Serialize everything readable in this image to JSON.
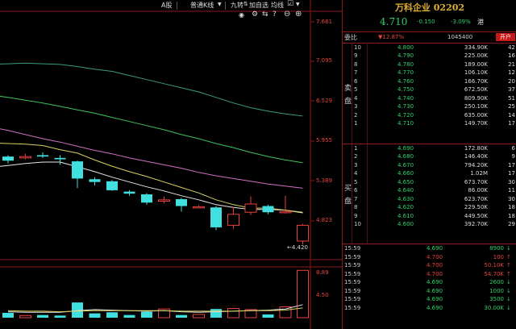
{
  "toolbar": {
    "market": "A股",
    "chart_type": "普通K线",
    "nine_turn": "九转",
    "add_watch": "加自选",
    "ma_toggle": "均线"
  },
  "price_axis": {
    "ticks": [
      "7.661",
      "7.095",
      "6.529",
      "5.955",
      "5.389",
      "4.823"
    ],
    "low_marker": "4.420"
  },
  "volume_axis": {
    "ticks": [
      "8.89",
      "4.50"
    ]
  },
  "colors": {
    "up": "#e84040",
    "down": "#40e0e0",
    "ma_white": "#e8e8e8",
    "ma_yellow": "#d8d060",
    "ma_pink": "#d070c0",
    "ma_green": "#40c060",
    "ma_teal": "#3a9a80"
  },
  "chart_data": {
    "type": "candlestick",
    "ylim": [
      4.2,
      7.661
    ],
    "candles": [
      {
        "o": 5.7,
        "c": 5.64,
        "h": 5.72,
        "l": 5.6
      },
      {
        "o": 5.68,
        "c": 5.7,
        "h": 5.74,
        "l": 5.66
      },
      {
        "o": 5.72,
        "c": 5.7,
        "h": 5.76,
        "l": 5.68
      },
      {
        "o": 5.68,
        "c": 5.66,
        "h": 5.72,
        "l": 5.58
      },
      {
        "o": 5.63,
        "c": 5.38,
        "h": 5.64,
        "l": 5.24
      },
      {
        "o": 5.37,
        "c": 5.33,
        "h": 5.4,
        "l": 5.28
      },
      {
        "o": 5.34,
        "c": 5.21,
        "h": 5.36,
        "l": 5.2
      },
      {
        "o": 5.19,
        "c": 5.16,
        "h": 5.21,
        "l": 5.13
      },
      {
        "o": 5.15,
        "c": 5.03,
        "h": 5.17,
        "l": 5.0
      },
      {
        "o": 5.05,
        "c": 5.07,
        "h": 5.12,
        "l": 5.02
      },
      {
        "o": 5.08,
        "c": 4.98,
        "h": 5.1,
        "l": 4.9
      },
      {
        "o": 4.96,
        "c": 4.97,
        "h": 4.99,
        "l": 4.95
      },
      {
        "o": 4.96,
        "c": 4.67,
        "h": 4.98,
        "l": 4.63
      },
      {
        "o": 4.7,
        "c": 4.86,
        "h": 4.97,
        "l": 4.65
      },
      {
        "o": 4.89,
        "c": 5.01,
        "h": 5.12,
        "l": 4.85
      },
      {
        "o": 4.98,
        "c": 4.89,
        "h": 5.0,
        "l": 4.86
      },
      {
        "o": 4.9,
        "c": 4.9,
        "h": 5.13,
        "l": 4.87
      },
      {
        "o": 4.47,
        "c": 4.7,
        "h": 4.72,
        "l": 4.42
      }
    ],
    "ma_lines": [
      {
        "name": "ma-white",
        "color": "#e8e8e8",
        "values": [
          5.57,
          5.6,
          5.62,
          5.62,
          5.55,
          5.48,
          5.4,
          5.33,
          5.26,
          5.2,
          5.13,
          5.07,
          5.0,
          4.96,
          4.93,
          4.93,
          4.92,
          4.88
        ]
      },
      {
        "name": "ma-yellow",
        "color": "#d8d060",
        "values": [
          5.89,
          5.88,
          5.86,
          5.8,
          5.75,
          5.65,
          5.56,
          5.48,
          5.41,
          5.33,
          5.25,
          5.17,
          5.07,
          5.0,
          4.95,
          4.95,
          4.92,
          4.89
        ]
      },
      {
        "name": "ma-pink",
        "color": "#d070c0",
        "values": [
          6.08,
          6.02,
          5.96,
          5.91,
          5.85,
          5.79,
          5.74,
          5.68,
          5.63,
          5.58,
          5.53,
          5.47,
          5.42,
          5.38,
          5.34,
          5.3,
          5.27,
          5.24
        ]
      },
      {
        "name": "ma-green",
        "color": "#40c060",
        "values": [
          6.56,
          6.52,
          6.48,
          6.43,
          6.38,
          6.33,
          6.27,
          6.21,
          6.15,
          6.09,
          6.02,
          5.96,
          5.89,
          5.83,
          5.76,
          5.7,
          5.65,
          5.61
        ]
      },
      {
        "name": "ma-teal",
        "color": "#3a9a80",
        "values": [
          7.05,
          7.06,
          7.05,
          7.04,
          7.01,
          6.97,
          6.94,
          6.88,
          6.82,
          6.76,
          6.7,
          6.64,
          6.56,
          6.48,
          6.41,
          6.36,
          6.32,
          6.29
        ]
      }
    ],
    "volume": {
      "ylim": [
        0,
        8.89
      ],
      "bars": [
        0.9,
        0.4,
        0.5,
        0.4,
        2.8,
        0.8,
        1.0,
        0.5,
        1.1,
        1.6,
        0.5,
        0.6,
        1.6,
        1.7,
        1.5,
        0.6,
        2.0,
        8.7
      ],
      "vol_ma_white": [
        1.1,
        1.0,
        1.0,
        1.0,
        1.3,
        1.5,
        1.4,
        1.3,
        1.2,
        1.3,
        1.1,
        1.0,
        1.1,
        1.2,
        1.3,
        1.4,
        1.6,
        2.4
      ],
      "vol_ma_yellow": [
        1.3,
        1.2,
        1.2,
        1.1,
        1.2,
        1.3,
        1.3,
        1.3,
        1.3,
        1.3,
        1.2,
        1.2,
        1.2,
        1.2,
        1.3,
        1.3,
        1.4,
        1.8
      ]
    }
  },
  "quote": {
    "title": "万科企业 02202",
    "price": "4.710",
    "change": "-0.150",
    "change_pct": "-3.09%",
    "flag": "港",
    "webi_label": "委比",
    "webi_value": "▼12.87%",
    "webi_volume": "1045400",
    "open_account": "开户"
  },
  "order_book": {
    "sell_label": [
      "卖",
      "盘"
    ],
    "buy_label": [
      "买",
      "盘"
    ],
    "sell": [
      {
        "lvl": "10",
        "price": "4.800",
        "vol": "334.90K",
        "cnt": "42"
      },
      {
        "lvl": "9",
        "price": "4.790",
        "vol": "225.00K",
        "cnt": "16"
      },
      {
        "lvl": "8",
        "price": "4.780",
        "vol": "189.00K",
        "cnt": "21"
      },
      {
        "lvl": "7",
        "price": "4.770",
        "vol": "106.10K",
        "cnt": "12"
      },
      {
        "lvl": "6",
        "price": "4.760",
        "vol": "166.70K",
        "cnt": "20"
      },
      {
        "lvl": "5",
        "price": "4.750",
        "vol": "672.50K",
        "cnt": "37"
      },
      {
        "lvl": "4",
        "price": "4.740",
        "vol": "809.90K",
        "cnt": "51"
      },
      {
        "lvl": "3",
        "price": "4.730",
        "vol": "250.10K",
        "cnt": "25"
      },
      {
        "lvl": "2",
        "price": "4.720",
        "vol": "635.00K",
        "cnt": "14"
      },
      {
        "lvl": "1",
        "price": "4.710",
        "vol": "149.70K",
        "cnt": "17"
      }
    ],
    "buy": [
      {
        "lvl": "1",
        "price": "4.690",
        "vol": "172.80K",
        "cnt": "6"
      },
      {
        "lvl": "2",
        "price": "4.680",
        "vol": "146.40K",
        "cnt": "9"
      },
      {
        "lvl": "3",
        "price": "4.670",
        "vol": "794.20K",
        "cnt": "17"
      },
      {
        "lvl": "4",
        "price": "4.660",
        "vol": "1.02M",
        "cnt": "17"
      },
      {
        "lvl": "5",
        "price": "4.650",
        "vol": "673.70K",
        "cnt": "30"
      },
      {
        "lvl": "6",
        "price": "4.640",
        "vol": "86.00K",
        "cnt": "11"
      },
      {
        "lvl": "7",
        "price": "4.630",
        "vol": "623.70K",
        "cnt": "30"
      },
      {
        "lvl": "8",
        "price": "4.620",
        "vol": "229.50K",
        "cnt": "18"
      },
      {
        "lvl": "9",
        "price": "4.610",
        "vol": "449.50K",
        "cnt": "18"
      },
      {
        "lvl": "10",
        "price": "4.600",
        "vol": "392.70K",
        "cnt": "29"
      }
    ]
  },
  "trades": [
    {
      "time": "15:59",
      "price": "4.690",
      "vol": "8900",
      "dir": "down"
    },
    {
      "time": "15:59",
      "price": "4.700",
      "vol": "100",
      "dir": "up"
    },
    {
      "time": "15:59",
      "price": "4.700",
      "vol": "50.10K",
      "dir": "up"
    },
    {
      "time": "15:59",
      "price": "4.700",
      "vol": "54.70K",
      "dir": "up"
    },
    {
      "time": "15:59",
      "price": "4.690",
      "vol": "2600",
      "dir": "down"
    },
    {
      "time": "15:59",
      "price": "4.690",
      "vol": "1000",
      "dir": "down"
    },
    {
      "time": "15:59",
      "price": "4.690",
      "vol": "3500",
      "dir": "down"
    },
    {
      "time": "15:59",
      "price": "4.690",
      "vol": "30.00K",
      "dir": "down"
    }
  ]
}
